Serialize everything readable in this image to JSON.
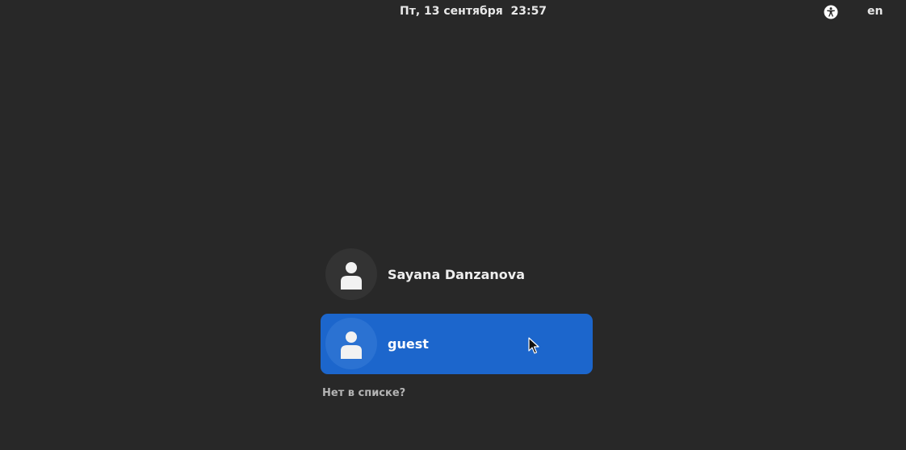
{
  "topbar": {
    "datetime": "Пт, 13 сентября  23:57",
    "accessibility_icon": "accessibility-icon",
    "language": "en"
  },
  "users": [
    {
      "name": "Sayana Danzanova",
      "avatar_icon": "person-icon",
      "selected": false
    },
    {
      "name": "guest",
      "avatar_icon": "person-icon",
      "selected": true
    }
  ],
  "not_listed_label": "Нет в списке?",
  "colors": {
    "background": "#282828",
    "selected_row": "#1c66cc",
    "text": "#e8e8e8"
  }
}
